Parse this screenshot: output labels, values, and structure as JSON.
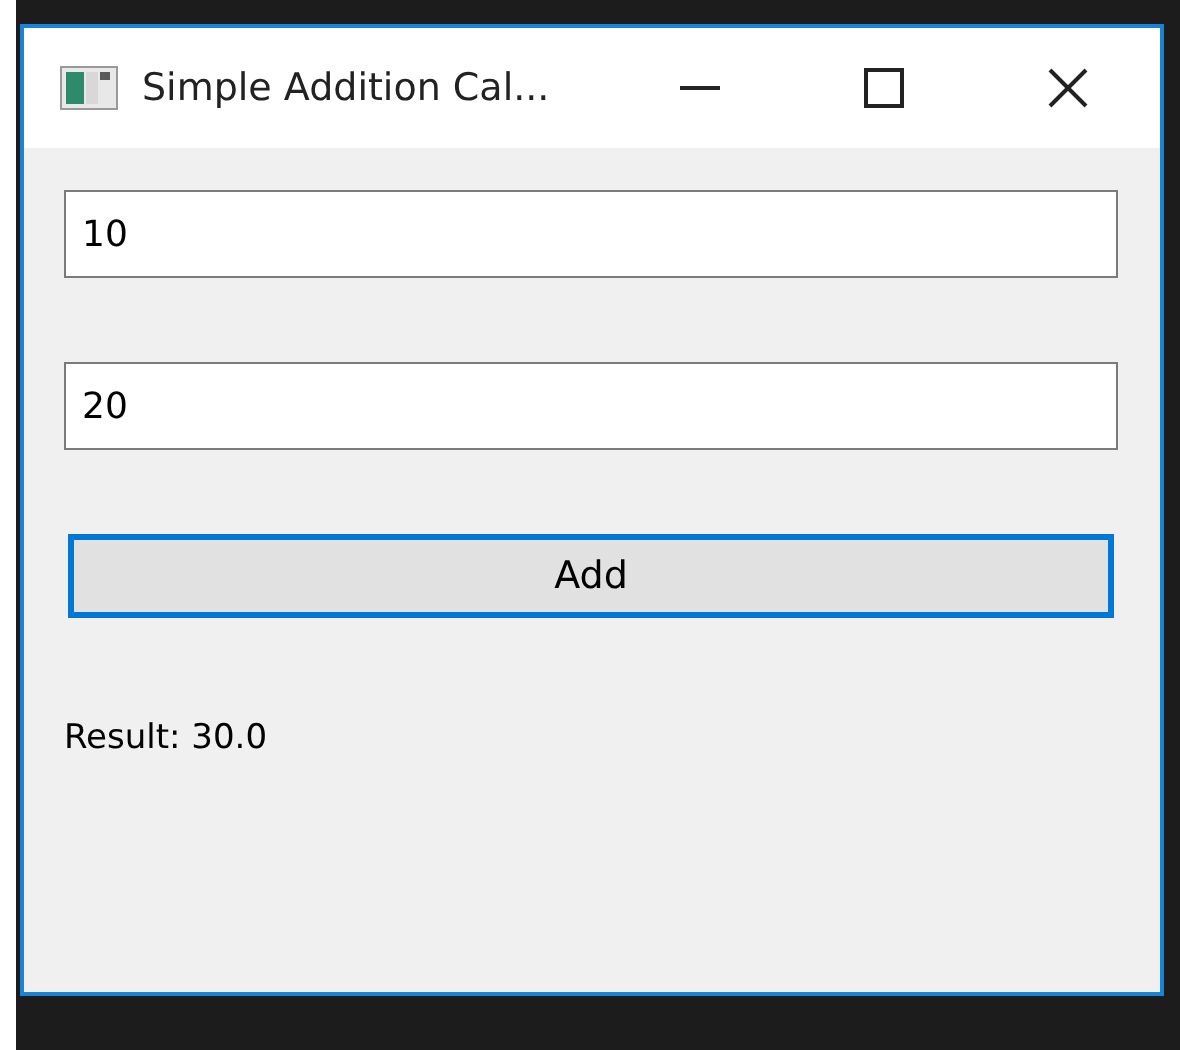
{
  "window": {
    "title": "Simple Addition Cal..."
  },
  "fields": [
    {
      "value": "10"
    },
    {
      "value": "20"
    }
  ],
  "button": {
    "label": "Add",
    "focused": true
  },
  "result": "Result: 30.0"
}
